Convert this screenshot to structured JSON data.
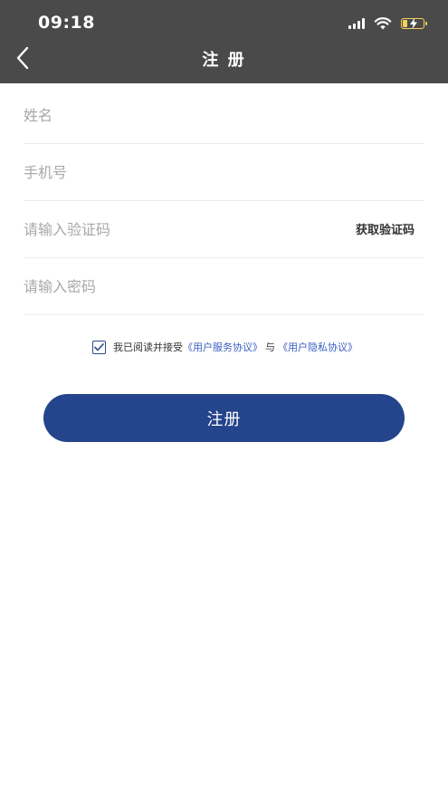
{
  "status_bar": {
    "time": "09:18"
  },
  "nav": {
    "title": "注 册"
  },
  "form": {
    "name_placeholder": "姓名",
    "phone_placeholder": "手机号",
    "code_placeholder": "请输入验证码",
    "get_code_label": "获取验证码",
    "password_placeholder": "请输入密码"
  },
  "agreement": {
    "checked": true,
    "prefix": "我已阅读并接受",
    "terms_link": "《用户服务协议》",
    "conjunction": "与",
    "privacy_link": "《用户隐私协议》"
  },
  "submit_label": "注册",
  "colors": {
    "header_bg": "#4a4a4a",
    "primary": "#24448b",
    "link": "#3a5fc0",
    "battery": "#f3d25a"
  },
  "icons": {
    "back": "chevron-left-icon",
    "signal": "cellular-signal-icon",
    "wifi": "wifi-icon",
    "battery": "battery-charging-icon",
    "check": "checkmark-icon"
  }
}
